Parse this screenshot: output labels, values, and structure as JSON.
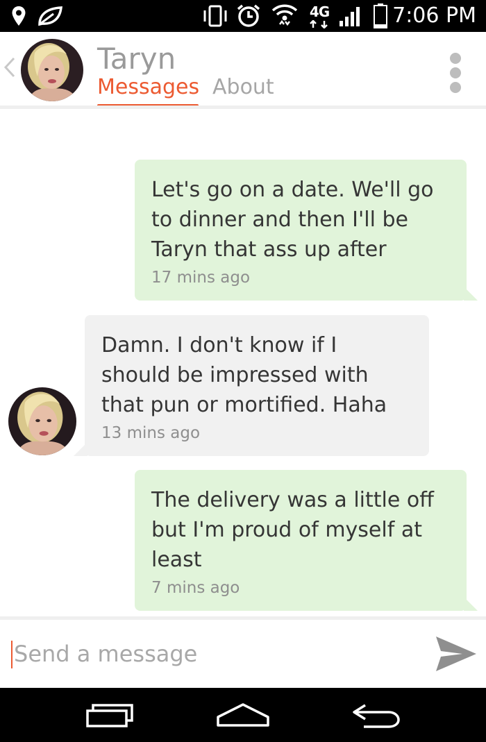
{
  "status_bar": {
    "time": "7:06 PM",
    "network": "4G",
    "icons": [
      "location-pin-icon",
      "leaf-icon",
      "vibrate-icon",
      "alarm-icon",
      "wifi-icon",
      "lte-icon",
      "signal-icon",
      "battery-icon"
    ]
  },
  "header": {
    "contact_name": "Taryn",
    "tabs": [
      {
        "label": "Messages",
        "active": true
      },
      {
        "label": "About",
        "active": false
      }
    ],
    "accent_color": "#ec5a31"
  },
  "messages": [
    {
      "direction": "sent",
      "text": "Let's go on a date. We'll go to dinner and then I'll be Taryn that ass up after",
      "time": "17 mins ago"
    },
    {
      "direction": "received",
      "text": "Damn. I don't know if I should be impressed with that pun or mortified. Haha",
      "time": "13 mins ago"
    },
    {
      "direction": "sent",
      "text": "The delivery was a little off but I'm proud of myself at least",
      "time": "7 mins ago"
    }
  ],
  "composer": {
    "placeholder": "Send a message",
    "value": ""
  },
  "colors": {
    "sent_bubble": "#e1f4da",
    "received_bubble": "#f1f1f1",
    "text": "#353535",
    "muted": "#8e8e8e"
  },
  "nav_bar": {
    "icons": [
      "recent-apps-icon",
      "home-icon",
      "back-icon"
    ]
  }
}
